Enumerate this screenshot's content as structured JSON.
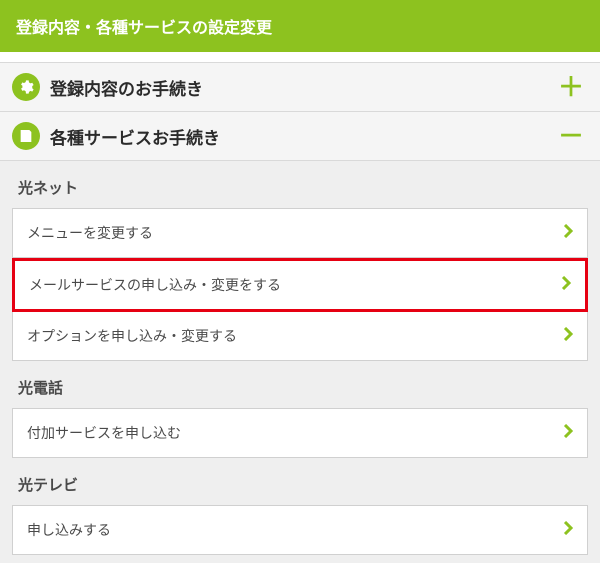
{
  "header": {
    "title": "登録内容・各種サービスの設定変更"
  },
  "accordions": [
    {
      "icon": "gear",
      "label": "登録内容のお手続き",
      "toggle": "＋",
      "expanded": false
    },
    {
      "icon": "form",
      "label": "各種サービスお手続き",
      "toggle": "－",
      "expanded": true
    }
  ],
  "sections": [
    {
      "heading": "光ネット",
      "items": [
        {
          "label": "メニューを変更する",
          "highlighted": false
        },
        {
          "label": "メールサービスの申し込み・変更をする",
          "highlighted": true
        },
        {
          "label": "オプションを申し込み・変更する",
          "highlighted": false
        }
      ]
    },
    {
      "heading": "光電話",
      "items": [
        {
          "label": "付加サービスを申し込む",
          "highlighted": false
        }
      ]
    },
    {
      "heading": "光テレビ",
      "items": [
        {
          "label": "申し込みする",
          "highlighted": false
        }
      ]
    }
  ]
}
